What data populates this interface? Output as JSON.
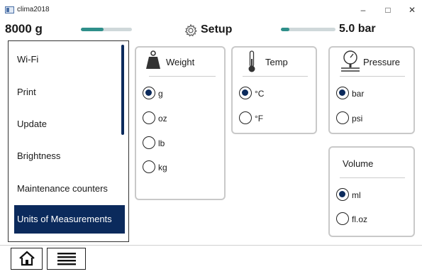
{
  "window": {
    "title": "clima2018",
    "minimize": "–",
    "maximize": "□",
    "close": "✕"
  },
  "status": {
    "weight_value": "8000 g",
    "weight_level": 0.45,
    "setup_label": "Setup",
    "pressure_level": 0.15,
    "pressure_value": "5.0 bar",
    "accent_color": "#2f8f8a"
  },
  "sidebar": {
    "items": [
      {
        "label": "Wi-Fi"
      },
      {
        "label": "Print"
      },
      {
        "label": "Update"
      },
      {
        "label": "Brightness"
      },
      {
        "label": "Maintenance counters"
      },
      {
        "label": "Units of Measurements"
      }
    ],
    "active_index": 5,
    "active_color": "#0b2a5c"
  },
  "groups": {
    "weight": {
      "title": "Weight",
      "icon": "weight-icon",
      "options": [
        {
          "label": "g",
          "selected": true
        },
        {
          "label": "oz",
          "selected": false
        },
        {
          "label": "lb",
          "selected": false
        },
        {
          "label": "kg",
          "selected": false
        }
      ]
    },
    "temp": {
      "title": "Temp",
      "icon": "thermometer-icon",
      "options": [
        {
          "label": "°C",
          "selected": true
        },
        {
          "label": "°F",
          "selected": false
        }
      ]
    },
    "pressure": {
      "title": "Pressure",
      "icon": "pressure-gauge-icon",
      "options": [
        {
          "label": "bar",
          "selected": true
        },
        {
          "label": "psi",
          "selected": false
        }
      ]
    },
    "volume": {
      "title": "Volume",
      "options": [
        {
          "label": "ml",
          "selected": true
        },
        {
          "label": "fl.oz",
          "selected": false
        }
      ]
    }
  },
  "bottom": {
    "home_icon": "home-icon",
    "menu_icon": "menu-icon"
  }
}
